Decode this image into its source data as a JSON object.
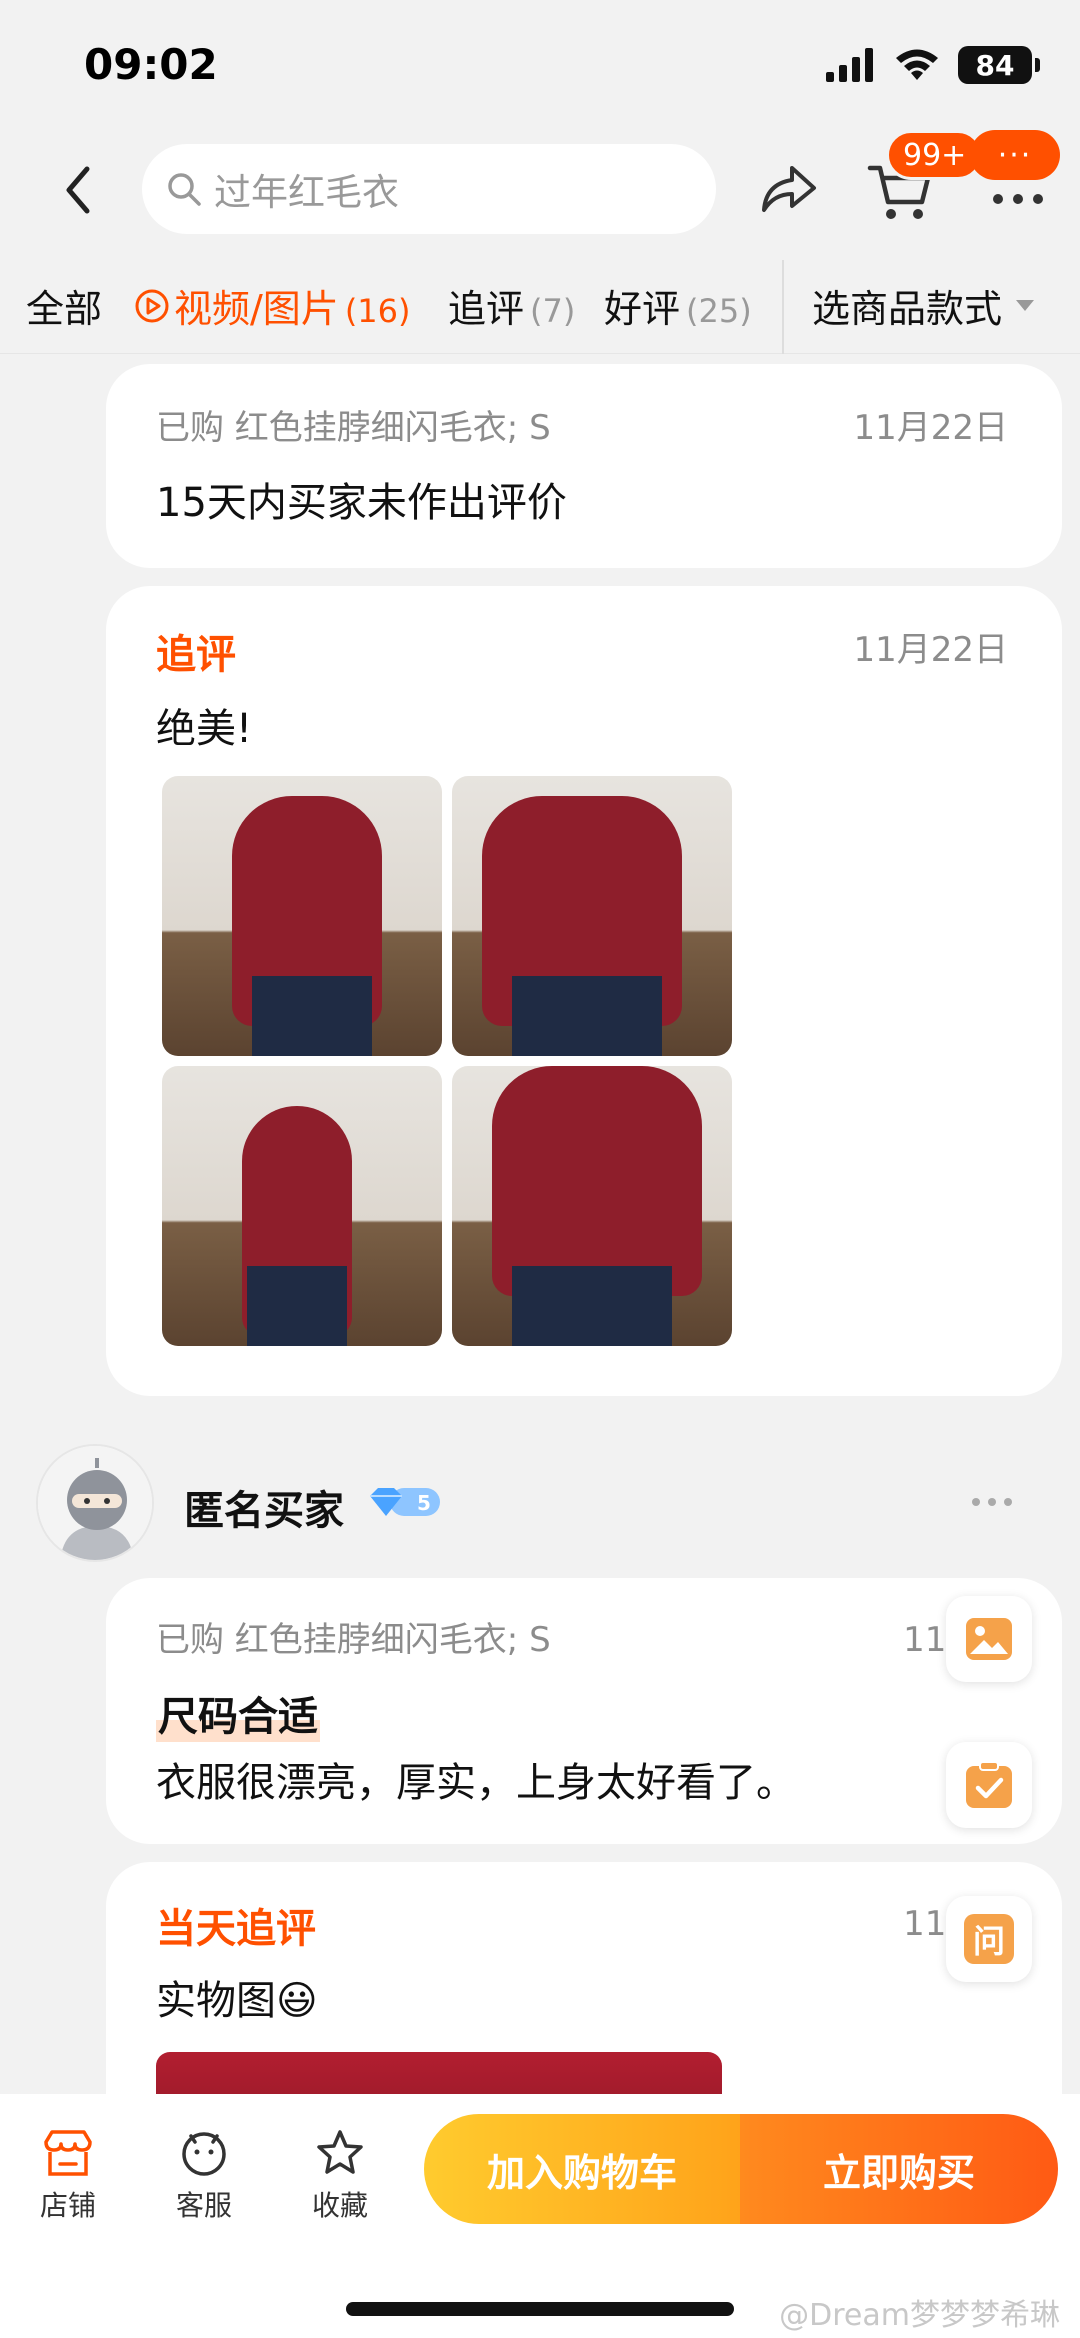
{
  "status_bar": {
    "time": "09:02",
    "battery": "84"
  },
  "nav": {
    "search_placeholder": "过年红毛衣",
    "cart_badge": "99+",
    "more_bubble": "···"
  },
  "filters": {
    "all": "全部",
    "media": {
      "label": "视频/图片",
      "count": "(16)"
    },
    "followup": {
      "label": "追评",
      "count": "(7)"
    },
    "good": {
      "label": "好评",
      "count": "(25)"
    },
    "style_select": "选商品款式"
  },
  "review1": {
    "purchased": "已购 红色挂脖细闪毛衣; S",
    "date": "11月22日",
    "text": "15天内买家未作出评价"
  },
  "followup1": {
    "title": "追评",
    "date": "11月22日",
    "text": "绝美!"
  },
  "user": {
    "name": "匿名买家",
    "level": "5"
  },
  "review2": {
    "purchased": "已购 红色挂脖细闪毛衣; S",
    "date": "11月1",
    "tag": "尺码合适",
    "text": "衣服很漂亮，厚实，上身太好看了。"
  },
  "followup2": {
    "title": "当天追评",
    "date": "11月1",
    "text": "实物图😃"
  },
  "float": {
    "ask": "问"
  },
  "bottom": {
    "shop": "店铺",
    "service": "客服",
    "favorite": "收藏",
    "add_cart": "加入购物车",
    "buy_now": "立即购买",
    "watermark": "@Dream梦梦梦希琳"
  },
  "colors": {
    "accent": "#ff5000",
    "cart_cta": "#ffb020",
    "buy_cta": "#ff6a14"
  }
}
